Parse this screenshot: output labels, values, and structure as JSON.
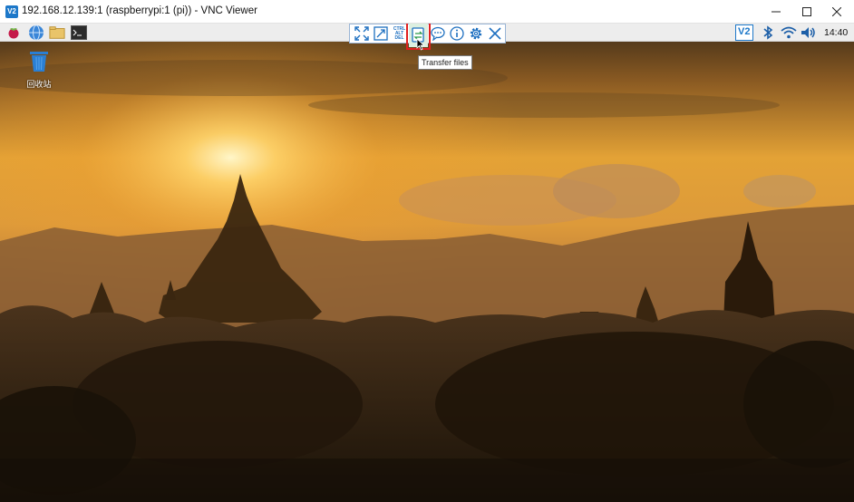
{
  "window": {
    "app_icon_text": "V2",
    "title": "192.168.12.139:1 (raspberrypi:1 (pi)) - VNC Viewer",
    "minimize_icon": "minimize-icon",
    "maximize_icon": "maximize-icon",
    "close_icon": "close-icon"
  },
  "panel": {
    "left_icons": [
      "raspberry-menu-icon",
      "web-browser-icon",
      "file-manager-icon",
      "terminal-icon"
    ],
    "right_icons": [
      "vnc-server-icon",
      "bluetooth-icon",
      "wifi-icon",
      "volume-icon"
    ],
    "vnc_badge_text": "V2",
    "clock": "14:40"
  },
  "vnc_toolbar": {
    "buttons": [
      "full-screen-icon",
      "scale-icon",
      "ctrl-alt-del-icon",
      "transfer-files-icon",
      "chat-icon",
      "info-icon",
      "settings-icon",
      "disconnect-icon"
    ],
    "ctrl_alt_del_lines": [
      "CTRL",
      "ALT",
      "DEL"
    ],
    "highlighted": "transfer-files-icon",
    "tooltip": "Transfer files"
  },
  "desktop": {
    "trash_label": "回收站",
    "accent_color": "#e02020"
  }
}
